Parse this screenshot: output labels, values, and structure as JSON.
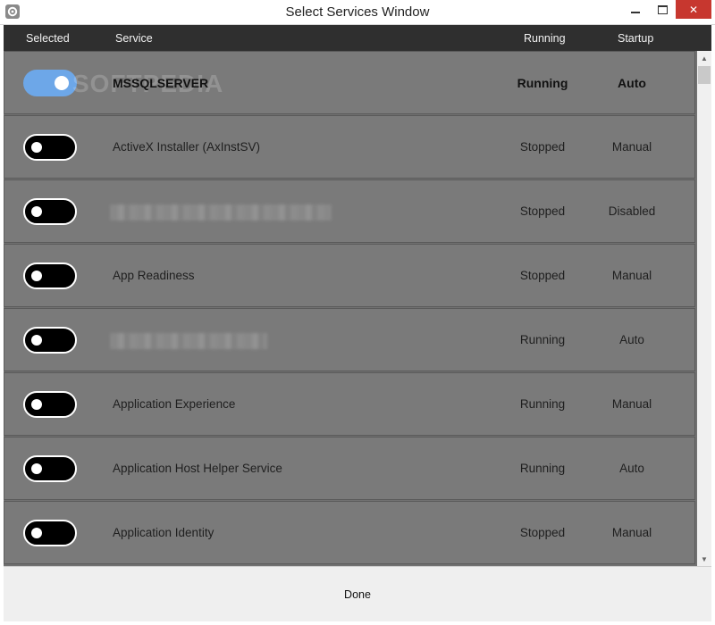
{
  "window": {
    "title": "Select Services Window",
    "icon": "gear-icon",
    "controls": {
      "minimize": "minimize-icon",
      "maximize": "maximize-icon",
      "close": "✕"
    }
  },
  "columns": {
    "selected": "Selected",
    "service": "Service",
    "running": "Running",
    "startup": "Startup"
  },
  "watermark": "SOFTPEDIA",
  "rows": [
    {
      "selected": true,
      "service": "MSSQLSERVER",
      "running": "Running",
      "startup": "Auto",
      "blurred": false
    },
    {
      "selected": false,
      "service": "ActiveX Installer (AxInstSV)",
      "running": "Stopped",
      "startup": "Manual",
      "blurred": false
    },
    {
      "selected": false,
      "service": "",
      "running": "Stopped",
      "startup": "Disabled",
      "blurred": true
    },
    {
      "selected": false,
      "service": "App Readiness",
      "running": "Stopped",
      "startup": "Manual",
      "blurred": false
    },
    {
      "selected": false,
      "service": "",
      "running": "Running",
      "startup": "Auto",
      "blurred": true
    },
    {
      "selected": false,
      "service": "Application Experience",
      "running": "Running",
      "startup": "Manual",
      "blurred": false
    },
    {
      "selected": false,
      "service": "Application Host Helper Service",
      "running": "Running",
      "startup": "Auto",
      "blurred": false
    },
    {
      "selected": false,
      "service": "Application Identity",
      "running": "Stopped",
      "startup": "Manual",
      "blurred": false
    }
  ],
  "footer": {
    "done_label": "Done"
  },
  "colors": {
    "toggle_on": "#6da7e8",
    "row_bg": "#7a7a7a",
    "header_bg": "#2f2f2f"
  }
}
